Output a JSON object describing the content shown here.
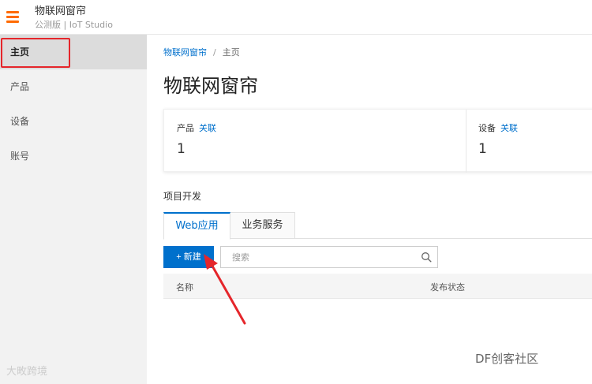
{
  "header": {
    "title": "物联网窗帘",
    "subtitle": "公测版 | IoT Studio",
    "menu_icon": "hamburger-icon",
    "accent": "#ff6a00"
  },
  "sidebar": {
    "items": [
      {
        "label": "主页",
        "active": true
      },
      {
        "label": "产品",
        "active": false
      },
      {
        "label": "设备",
        "active": false
      },
      {
        "label": "账号",
        "active": false
      }
    ],
    "highlight_color": "#e5262b"
  },
  "breadcrumb": {
    "parent": "物联网窗帘",
    "separator": "/",
    "current": "主页"
  },
  "page": {
    "title": "物联网窗帘"
  },
  "stats": {
    "product": {
      "label": "产品",
      "link": "关联",
      "value": "1"
    },
    "device": {
      "label": "设备",
      "link": "关联",
      "value": "1"
    }
  },
  "project": {
    "title": "项目开发",
    "tabs": [
      {
        "label": "Web应用",
        "active": true
      },
      {
        "label": "业务服务",
        "active": false
      }
    ],
    "new_button": "+ 新建",
    "search_placeholder": "搜索",
    "search_icon": "search-icon",
    "table_headers": [
      "名称",
      "发布状态"
    ]
  },
  "watermarks": {
    "left": "大畋跨境",
    "right": "DF创客社区"
  },
  "colors": {
    "primary": "#0070cc",
    "annotation_arrow": "#e5262b"
  }
}
